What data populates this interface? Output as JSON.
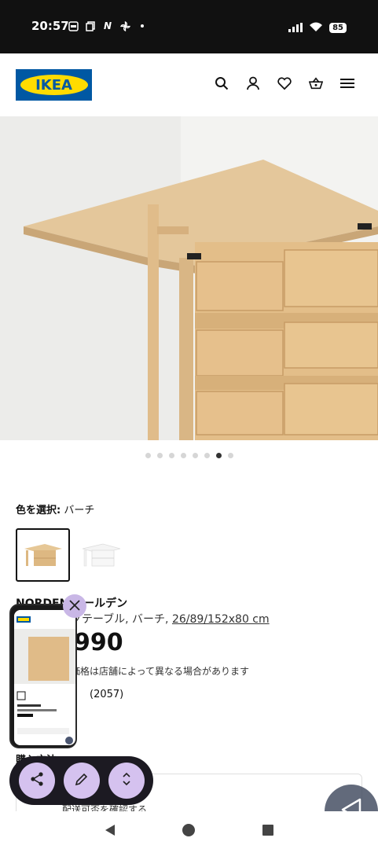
{
  "status_bar": {
    "time": "20:57",
    "battery": "85",
    "left_icons": [
      "sim-icon",
      "copy-icon",
      "n-icon",
      "pinwheel-icon",
      "dot-icon"
    ],
    "right_icons": [
      "signal-icon",
      "wifi-icon",
      "battery-icon"
    ]
  },
  "header": {
    "logo_text": "IKEA",
    "icons": [
      "search-icon",
      "account-icon",
      "wishlist-heart-icon",
      "cart-icon",
      "menu-icon"
    ],
    "brand_blue": "#0058a3",
    "brand_yellow": "#ffdb00"
  },
  "gallery": {
    "dot_count": 8,
    "active_index": 6
  },
  "color_select": {
    "label": "色を選択:",
    "value": "バーチ"
  },
  "product": {
    "name": "NORDEN ノールデン",
    "desc_prefix": "ゲートレッグテーブル, バーチ, ",
    "size": "26/89/152x80 cm",
    "price": "¥29,990",
    "price_note": "価格は店舗によって異なる場合があります",
    "review_count": "(2057)"
  },
  "purchase": {
    "label": "購入方法",
    "delivery_text": "配送可否を確認する"
  },
  "overlay": {
    "close_icon": "close-icon",
    "tools": [
      "share-icon",
      "edit-pencil-icon",
      "expand-vertical-icon"
    ],
    "back_icon": "back-triangle-icon"
  },
  "navigation": [
    "back-icon",
    "home-icon",
    "recents-icon"
  ]
}
